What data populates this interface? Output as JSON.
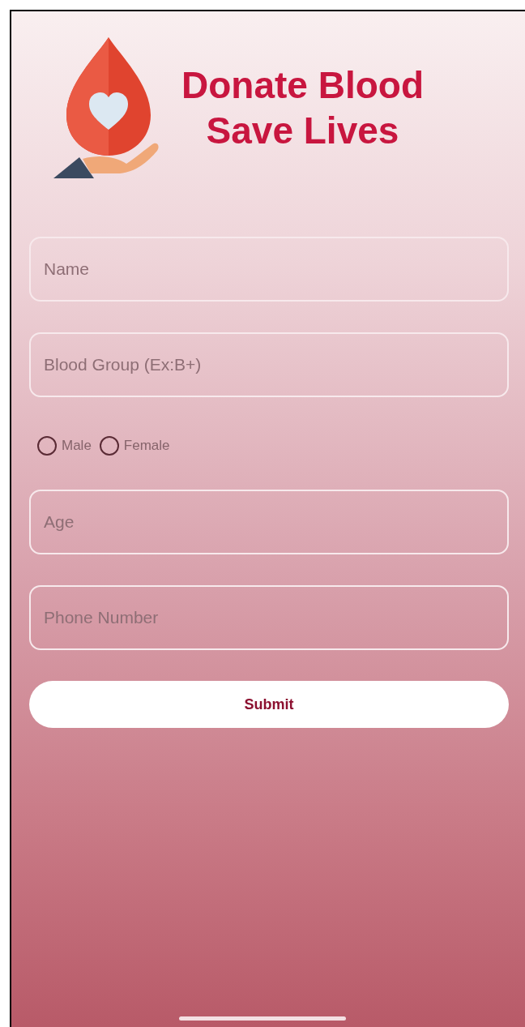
{
  "header": {
    "title_lines": [
      "Donate Blood",
      "Save Lives"
    ]
  },
  "fields": [
    {
      "placeholder": "Name"
    },
    {
      "placeholder": "Blood Group (Ex:B+)"
    }
  ],
  "gender": [
    {
      "label": "Male",
      "selected": false
    },
    {
      "label": "Female",
      "selected": false
    }
  ],
  "fields_2": [
    {
      "placeholder": "Age"
    },
    {
      "placeholder": "Phone Number"
    }
  ],
  "submit": {
    "label": "Submit"
  }
}
